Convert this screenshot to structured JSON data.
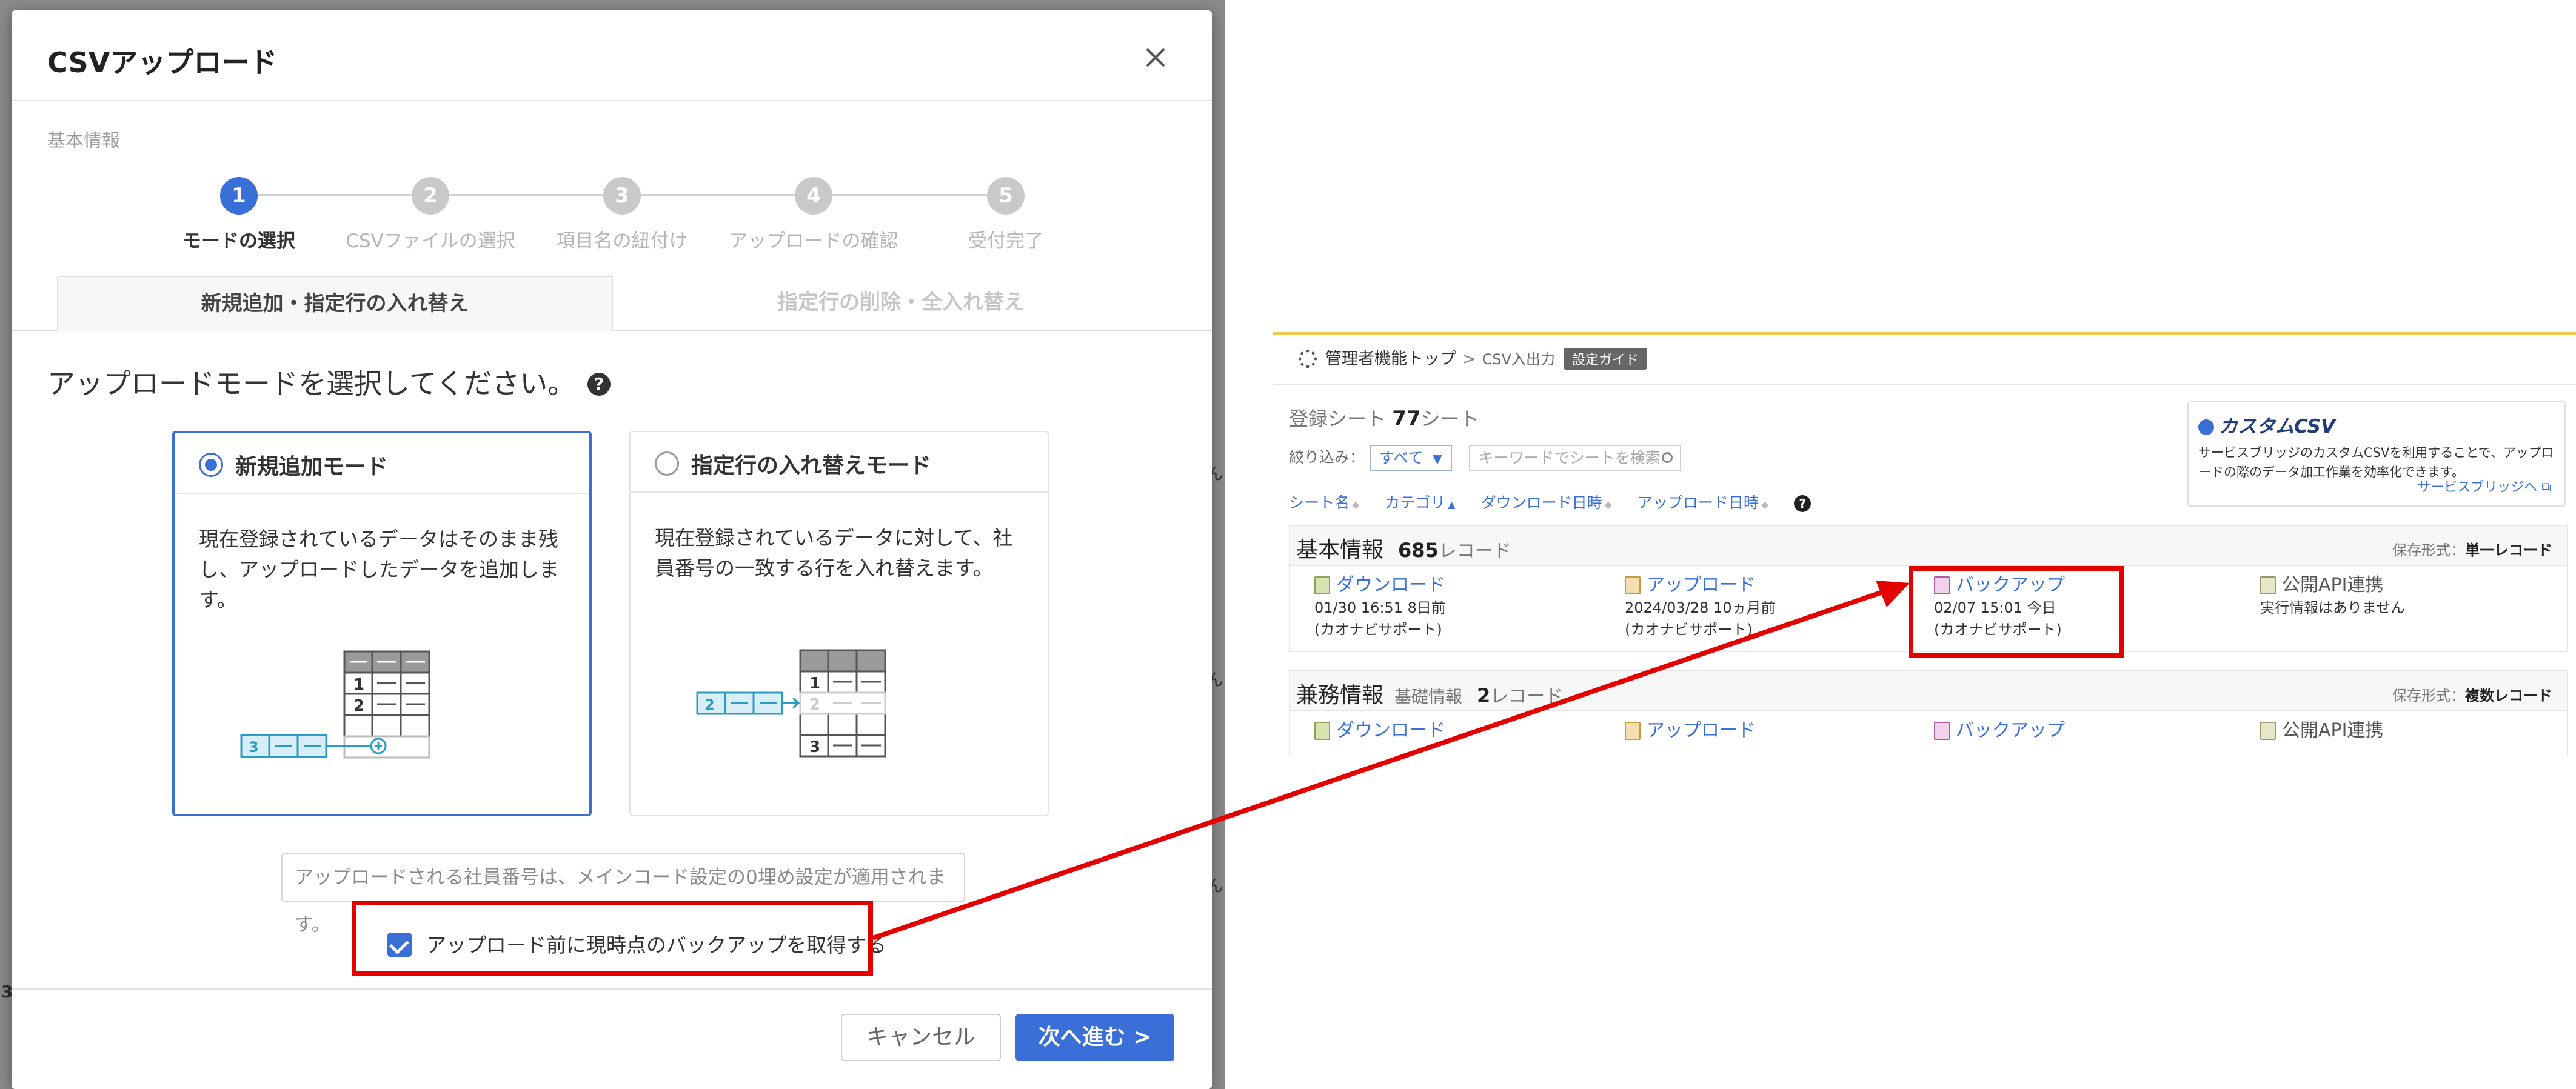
{
  "modal": {
    "title": "CSVアップロード",
    "section_label": "基本情報",
    "steps": [
      {
        "num": "1",
        "label": "モードの選択"
      },
      {
        "num": "2",
        "label": "CSVファイルの選択"
      },
      {
        "num": "3",
        "label": "項目名の紐付け"
      },
      {
        "num": "4",
        "label": "アップロードの確認"
      },
      {
        "num": "5",
        "label": "受付完了"
      }
    ],
    "tabs": [
      "新規追加・指定行の入れ替え",
      "指定行の削除・全入れ替え"
    ],
    "prompt": "アップロードモードを選択してください。",
    "help_glyph": "?",
    "modes": [
      {
        "title": "新規追加モード",
        "desc": "現在登録されているデータはそのまま残し、アップロードしたデータを追加します。",
        "selected": true
      },
      {
        "title": "指定行の入れ替えモード",
        "desc": "現在登録されているデータに対して、社員番号の一致する行を入れ替えます。",
        "selected": false
      }
    ],
    "illus_left": {
      "top": [
        "1",
        "2"
      ],
      "add": "3"
    },
    "illus_right": {
      "rows": [
        "1",
        "2",
        "3"
      ],
      "incoming": "2"
    },
    "notice": "アップロードされる社員番号は、メインコード設定の0埋め設定が適用されます。",
    "backup_label": "アップロード前に現時点のバックアップを取得する",
    "backup_checked": true,
    "cancel_label": "キャンセル",
    "next_label": "次へ進む >"
  },
  "background_fragments": [
    "ん",
    "ん",
    "ん",
    "3"
  ],
  "panel": {
    "breadcrumb": {
      "root": "管理者機能トップ",
      "sep": ">",
      "current": "CSV入出力",
      "badge": "設定ガイド"
    },
    "sheets": {
      "prefix": "登録シート",
      "count": "77",
      "unit": "シート"
    },
    "filter": {
      "label": "絞り込み：",
      "value": "すべて",
      "search_placeholder": "キーワードでシートを検索"
    },
    "sort_columns": [
      "シート名",
      "カテゴリ",
      "ダウンロード日時",
      "アップロード日時"
    ],
    "ad": {
      "title": "カスタムCSV",
      "text": "サービスブリッジのカスタムCSVを利用することで、アップロードの際のデータ加工作業を効率化できます。",
      "link": "サービスブリッジへ"
    },
    "groups": [
      {
        "name": "基本情報",
        "category": "",
        "count": "685",
        "unit": "レコード",
        "format_label": "保存形式：",
        "format_value": "単一レコード",
        "actions": [
          {
            "label": "ダウンロード",
            "line1": "01/30 16:51 8日前",
            "line2": "(カオナビサポート)"
          },
          {
            "label": "アップロード",
            "line1": "2024/03/28 10ヵ月前",
            "line2": "(カオナビサポート)"
          },
          {
            "label": "バックアップ",
            "line1": "02/07 15:01 今日",
            "line2": "(カオナビサポート)"
          },
          {
            "label": "公開API連携",
            "line1": "実行情報はありません",
            "line2": ""
          }
        ]
      },
      {
        "name": "兼務情報",
        "category": "基礎情報",
        "count": "2",
        "unit": "レコード",
        "format_label": "保存形式：",
        "format_value": "複数レコード",
        "actions": [
          {
            "label": "ダウンロード",
            "line1": "",
            "line2": ""
          },
          {
            "label": "アップロード",
            "line1": "",
            "line2": ""
          },
          {
            "label": "バックアップ",
            "line1": "",
            "line2": ""
          },
          {
            "label": "公開API連携",
            "line1": "",
            "line2": ""
          }
        ]
      }
    ]
  },
  "colors": {
    "accent": "#3a6fd8",
    "highlight": "#e50000",
    "yellow_rule": "#f2c94c"
  }
}
